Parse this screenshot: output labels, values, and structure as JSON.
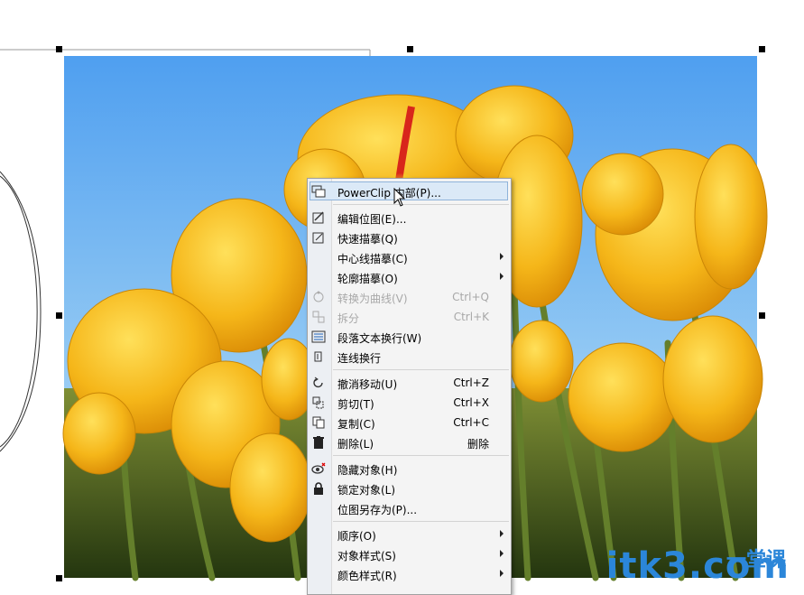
{
  "menu": {
    "items": [
      {
        "label": "PowerClip 内部(P)...",
        "shortcut": "",
        "submenu": false,
        "disabled": false,
        "highlight": true,
        "icon": "powerclip-icon"
      },
      {
        "sep": true
      },
      {
        "label": "编辑位图(E)...",
        "shortcut": "",
        "submenu": false,
        "disabled": false,
        "icon": "edit-bitmap-icon"
      },
      {
        "label": "快速描摹(Q)",
        "shortcut": "",
        "submenu": false,
        "disabled": false,
        "icon": "quick-trace-icon"
      },
      {
        "label": "中心线描摹(C)",
        "shortcut": "",
        "submenu": true,
        "disabled": false,
        "icon": ""
      },
      {
        "label": "轮廓描摹(O)",
        "shortcut": "",
        "submenu": true,
        "disabled": false,
        "icon": ""
      },
      {
        "label": "转换为曲线(V)",
        "shortcut": "Ctrl+Q",
        "submenu": false,
        "disabled": true,
        "icon": "convert-curves-icon"
      },
      {
        "label": "拆分",
        "shortcut": "Ctrl+K",
        "submenu": false,
        "disabled": true,
        "icon": "break-apart-icon"
      },
      {
        "label": "段落文本换行(W)",
        "shortcut": "",
        "submenu": false,
        "disabled": false,
        "icon": "text-wrap-icon"
      },
      {
        "label": "连线换行",
        "shortcut": "",
        "submenu": false,
        "disabled": false,
        "icon": "connector-wrap-icon"
      },
      {
        "sep": true
      },
      {
        "label": "撤消移动(U)",
        "shortcut": "Ctrl+Z",
        "submenu": false,
        "disabled": false,
        "icon": "undo-icon"
      },
      {
        "label": "剪切(T)",
        "shortcut": "Ctrl+X",
        "submenu": false,
        "disabled": false,
        "icon": "cut-icon"
      },
      {
        "label": "复制(C)",
        "shortcut": "Ctrl+C",
        "submenu": false,
        "disabled": false,
        "icon": "copy-icon"
      },
      {
        "label": "删除(L)",
        "shortcut": "删除",
        "submenu": false,
        "disabled": false,
        "icon": "trash-icon"
      },
      {
        "sep": true
      },
      {
        "label": "隐藏对象(H)",
        "shortcut": "",
        "submenu": false,
        "disabled": false,
        "icon": "hide-icon"
      },
      {
        "label": "锁定对象(L)",
        "shortcut": "",
        "submenu": false,
        "disabled": false,
        "icon": "lock-icon"
      },
      {
        "label": "位图另存为(P)...",
        "shortcut": "",
        "submenu": false,
        "disabled": false,
        "icon": ""
      },
      {
        "sep": true
      },
      {
        "label": "顺序(O)",
        "shortcut": "",
        "submenu": true,
        "disabled": false,
        "icon": ""
      },
      {
        "label": "对象样式(S)",
        "shortcut": "",
        "submenu": true,
        "disabled": false,
        "icon": ""
      },
      {
        "label": "颜色样式(R)",
        "shortcut": "",
        "submenu": true,
        "disabled": false,
        "icon": ""
      }
    ]
  },
  "watermark": {
    "text": "itk3.com",
    "cn": "一堂课"
  },
  "colors": {
    "sky": "#6fb2ee",
    "tulip": "#f4b51c",
    "stem": "#5d7a2a",
    "accent": "#2b86d9"
  }
}
